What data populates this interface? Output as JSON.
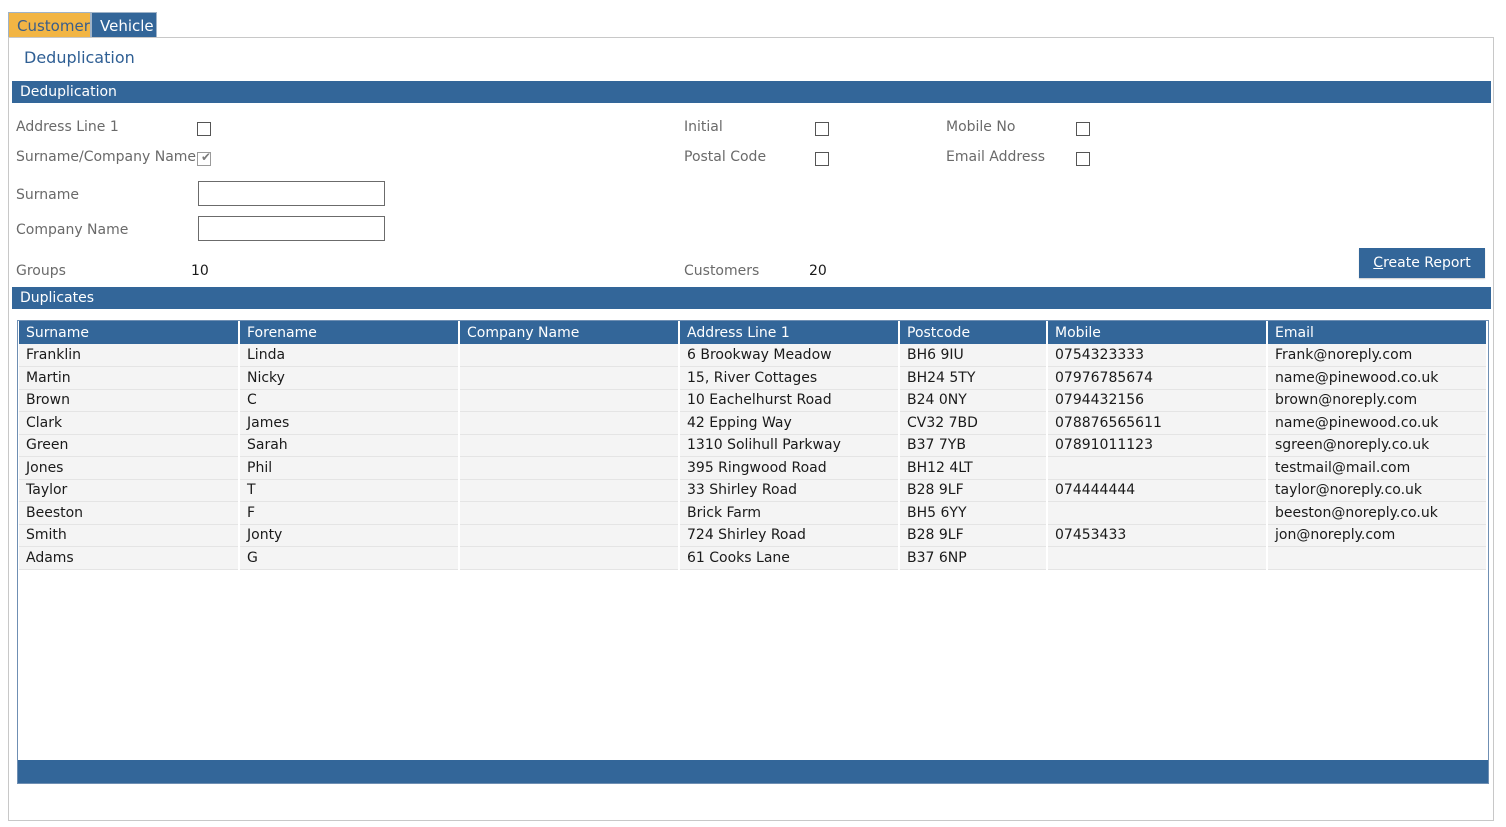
{
  "tabs": [
    {
      "label": "Customer"
    },
    {
      "label": "Vehicle"
    }
  ],
  "page": {
    "title": "Deduplication"
  },
  "dedup_section": {
    "header": "Deduplication",
    "options": [
      {
        "label": "Address Line 1",
        "checked": false
      },
      {
        "label": "Surname/Company Name",
        "checked": true
      },
      {
        "label": "Initial",
        "checked": false
      },
      {
        "label": "Postal Code",
        "checked": false
      },
      {
        "label": "Mobile No",
        "checked": false
      },
      {
        "label": "Email Address",
        "checked": false
      }
    ],
    "surname_label": "Surname",
    "surname_value": "",
    "company_label": "Company Name",
    "company_value": "",
    "groups_label": "Groups",
    "groups_value": "10",
    "customers_label": "Customers",
    "customers_value": "20",
    "create_report_first": "C",
    "create_report_rest": "reate Report"
  },
  "duplicates_section": {
    "header": "Duplicates",
    "columns": [
      "Surname",
      "Forename",
      "Company Name",
      "Address Line 1",
      "Postcode",
      "Mobile",
      "Email"
    ],
    "rows": [
      [
        "Franklin",
        "Linda",
        "",
        "6 Brookway Meadow",
        "BH6 9IU",
        "0754323333",
        "Frank@noreply.com"
      ],
      [
        "Martin",
        "Nicky",
        "",
        "15, River Cottages",
        "BH24 5TY",
        "07976785674",
        "name@pinewood.co.uk"
      ],
      [
        "Brown",
        "C",
        "",
        "10 Eachelhurst Road",
        "B24 0NY",
        "0794432156",
        "brown@noreply.com"
      ],
      [
        "Clark",
        "James",
        "",
        "42 Epping Way",
        "CV32 7BD",
        "078876565611",
        "name@pinewood.co.uk"
      ],
      [
        "Green",
        "Sarah",
        "",
        "1310 Solihull Parkway",
        "B37 7YB",
        "07891011123",
        "sgreen@noreply.co.uk"
      ],
      [
        "Jones",
        "Phil",
        "",
        "395 Ringwood Road",
        "BH12 4LT",
        "",
        "testmail@mail.com"
      ],
      [
        "Taylor",
        "T",
        "",
        "33 Shirley Road",
        "B28 9LF",
        "074444444",
        "taylor@noreply.co.uk"
      ],
      [
        "Beeston",
        "F",
        "",
        "Brick Farm",
        "BH5 6YY",
        "",
        "beeston@noreply.co.uk"
      ],
      [
        "Smith",
        "Jonty",
        "",
        "724 Shirley Road",
        "B28 9LF",
        "07453433",
        "jon@noreply.com"
      ],
      [
        "Adams",
        "G",
        "",
        "61 Cooks Lane",
        "B37 6NP",
        "",
        ""
      ]
    ]
  }
}
